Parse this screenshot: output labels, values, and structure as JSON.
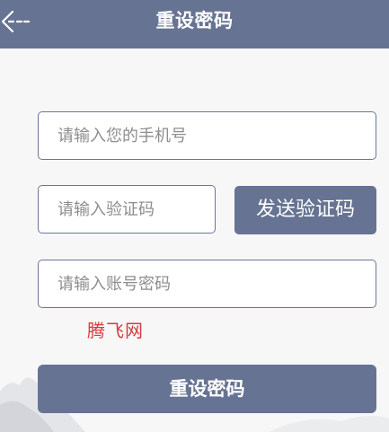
{
  "header": {
    "title": "重设密码",
    "back_icon": "back-arrow-icon"
  },
  "form": {
    "phone_placeholder": "请输入您的手机号",
    "code_placeholder": "请输入验证码",
    "send_code_label": "发送验证码",
    "password_placeholder": "请输入账号密码",
    "submit_label": "重设密码"
  },
  "watermark": {
    "text": "腾飞网"
  },
  "colors": {
    "primary": "#667392",
    "border": "#69769a",
    "watermark": "#d8393a",
    "background": "#f7f7f8"
  }
}
